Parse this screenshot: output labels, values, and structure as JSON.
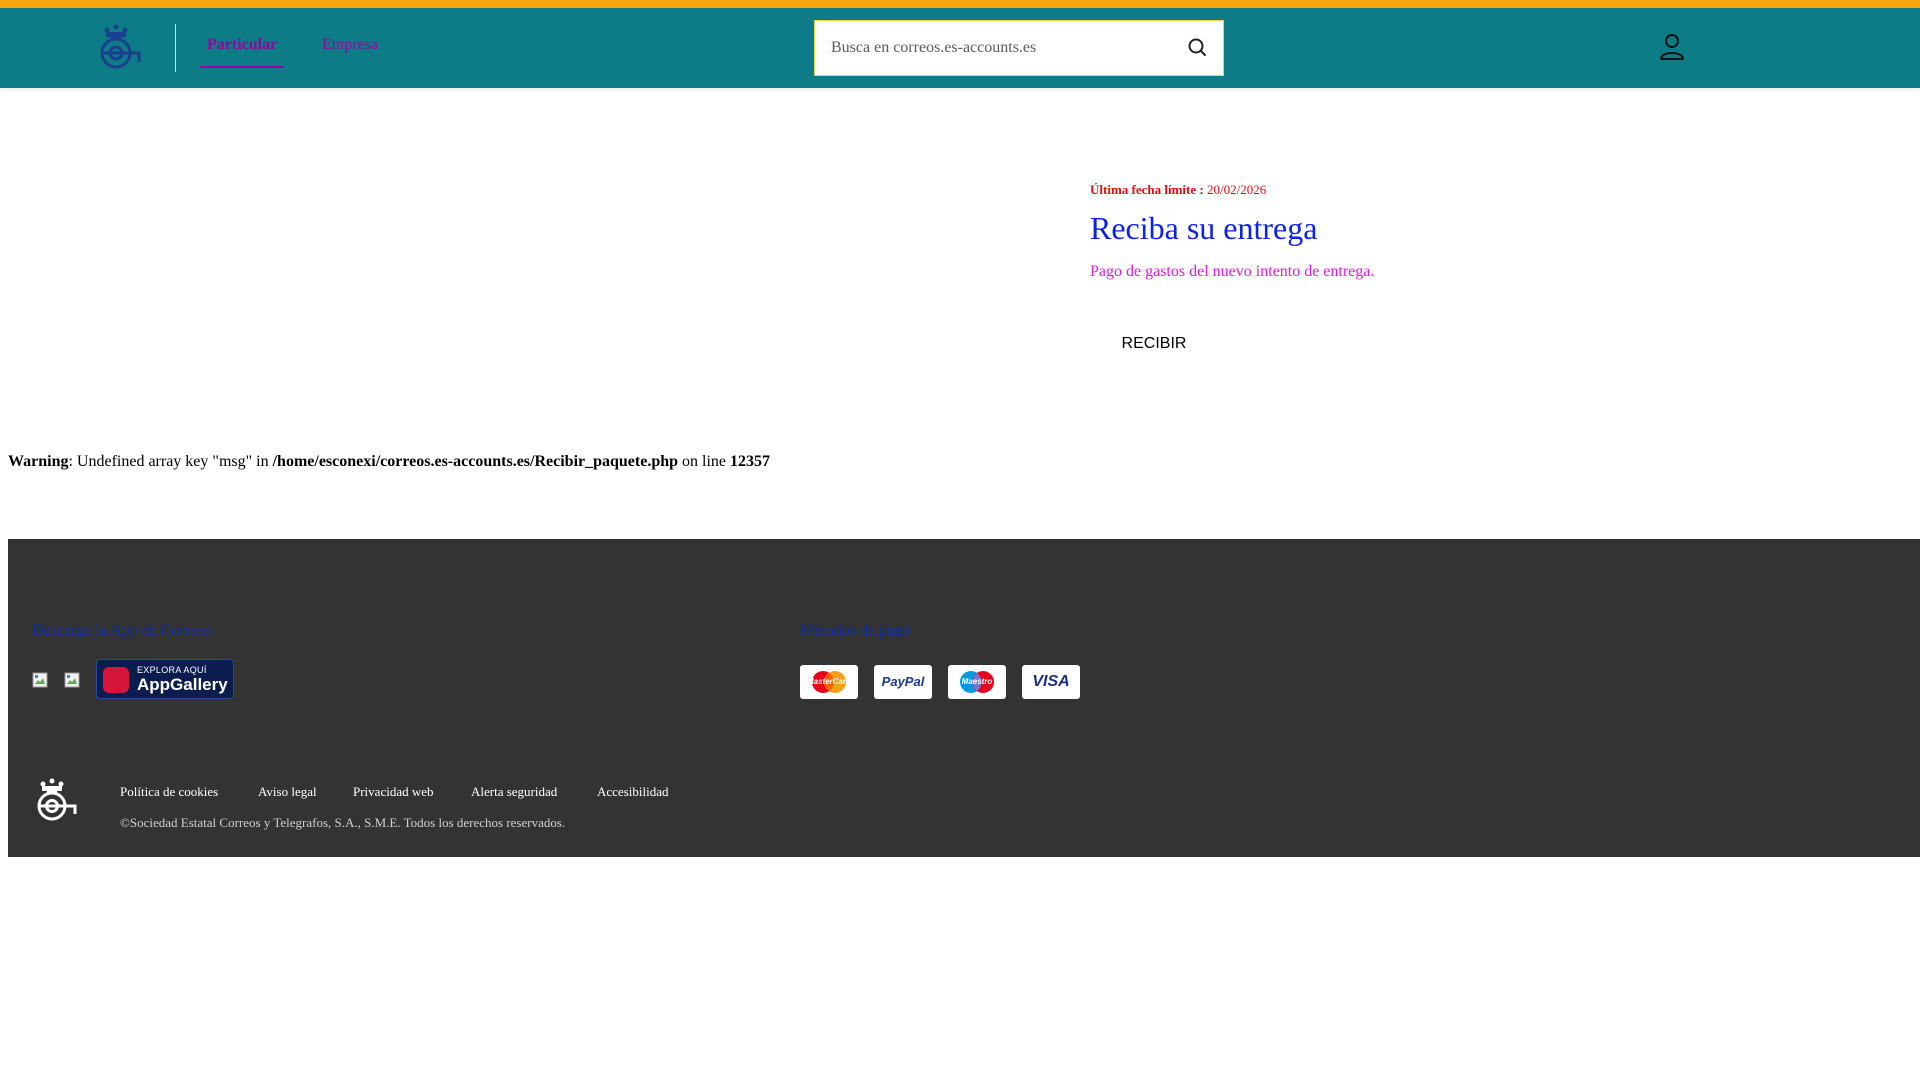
{
  "header": {
    "accent_color": "#f7a50c",
    "bar_color": "#0e7c86",
    "logo_icon": "posthorn-crown-icon",
    "tabs": [
      {
        "label": "Particular",
        "active": true
      },
      {
        "label": "Empresa",
        "active": false
      }
    ],
    "search": {
      "placeholder": "Busca en correos.es-accounts.es",
      "icon": "search-icon"
    },
    "user_icon": "user-icon"
  },
  "main": {
    "deadline_label": "Última fecha límite :",
    "deadline_date": "20/02/2026",
    "title": "Reciba su entrega",
    "subtitle": "Pago de gastos del nuevo intento de entrega.",
    "button_label": "RECIBIR"
  },
  "warning": {
    "label": "Warning",
    "text1": ": Undefined array key \"msg\" in ",
    "path": "/home/esconexi/correos.es-accounts.es/Recibir_paquete.php",
    "text2": " on line ",
    "line": "12357"
  },
  "footer": {
    "app_heading": "Descarga la App de Correos",
    "appgallery_small": "EXPLORA AQUÍ",
    "appgallery_big": "AppGallery",
    "payment_heading": "Métodos de pago",
    "payment_methods": [
      "MasterCard",
      "PayPal",
      "Maestro",
      "VISA"
    ],
    "links": [
      "Política de cookies",
      "Aviso legal",
      "Privacidad web",
      "Alerta seguridad",
      "Accesibilidad"
    ],
    "copyright": "©Sociedad Estatal Correos y Telegrafos, S.A., S.M.E. Todos los derechos reservados."
  }
}
